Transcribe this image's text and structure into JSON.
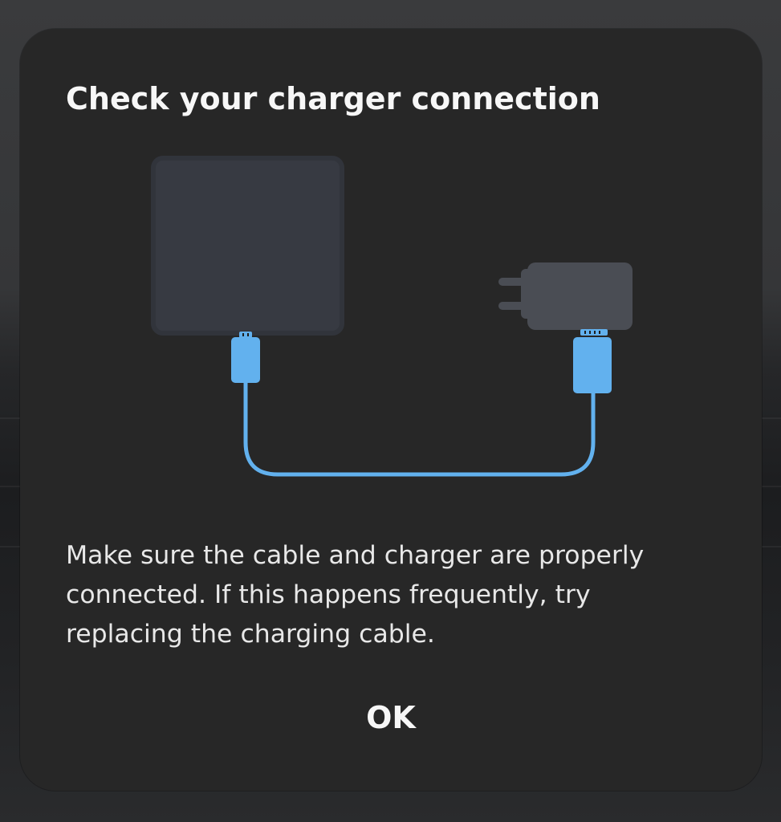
{
  "dialog": {
    "title": "Check your charger connection",
    "message": "Make sure the cable and charger are properly connected. If this happens frequently, try replacing the charging cable.",
    "ok_label": "OK"
  },
  "illustration": {
    "icons": [
      "phone-icon",
      "usb-c-connector-icon",
      "charging-cable-icon",
      "wall-charger-icon"
    ],
    "colors": {
      "phone": "#373a42",
      "charger": "#4a4d54",
      "cable": "#62b1ee",
      "dialog_background": "#272727"
    }
  }
}
